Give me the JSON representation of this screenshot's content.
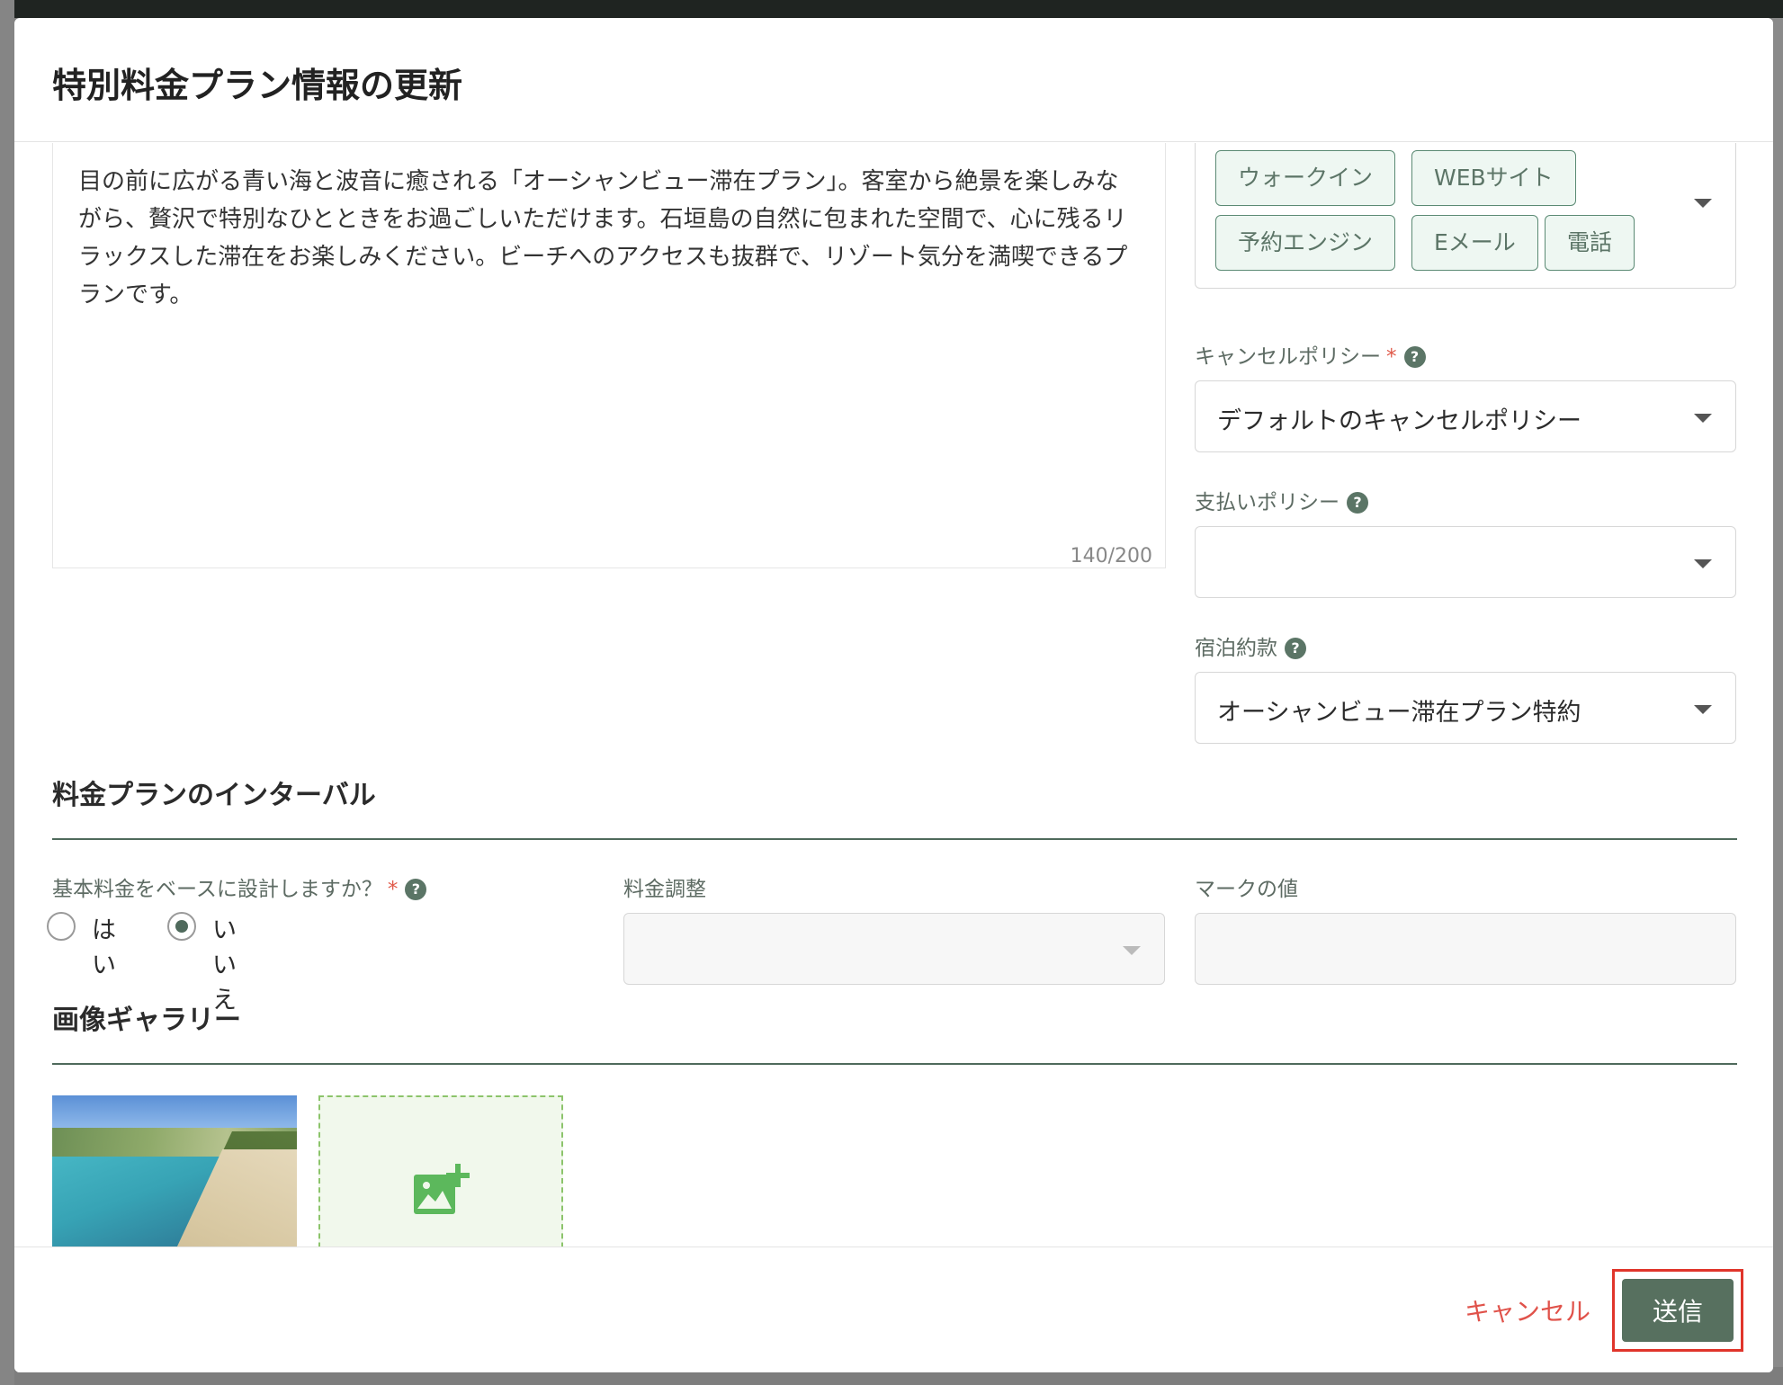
{
  "modal": {
    "title": "特別料金プラン情報の更新"
  },
  "description": {
    "text": "目の前に広がる青い海と波音に癒される「オーシャンビュー滞在プラン」。客室から絶景を楽しみながら、贅沢で特別なひとときをお過ごしいただけます。石垣島の自然に包まれた空間で、心に残るリラックスした滞在をお楽しみください。ビーチへのアクセスも抜群で、リゾート気分を満喫できるプランです。",
    "counter": "140/200"
  },
  "channels": {
    "chips": [
      "ウォークイン",
      "WEBサイト",
      "予約エンジン",
      "Eメール",
      "電話"
    ]
  },
  "cancel_policy": {
    "label": "キャンセルポリシー",
    "required": "*",
    "value": "デフォルトのキャンセルポリシー"
  },
  "payment_policy": {
    "label": "支払いポリシー",
    "value": ""
  },
  "terms": {
    "label": "宿泊約款",
    "value": "オーシャンビュー滞在プラン特約"
  },
  "interval_section": {
    "title": "料金プランのインターバル",
    "base_question": "基本料金をベースに設計しますか？",
    "required": "*",
    "options": [
      "はい",
      "いいえ"
    ],
    "selected": "いいえ",
    "rate_adjust_label": "料金調整",
    "mark_value_label": "マークの値"
  },
  "gallery": {
    "title": "画像ギャラリー"
  },
  "help_glyph": "?",
  "footer": {
    "cancel": "キャンセル",
    "submit": "送信"
  },
  "colors": {
    "accent": "#57705f",
    "danger": "#e0524a",
    "chip_bg": "#eef7f2",
    "add_image": "#5cb85c"
  },
  "icons": {
    "add_image": "add-photo-icon",
    "caret": "chevron-down-icon",
    "help": "help-icon"
  }
}
